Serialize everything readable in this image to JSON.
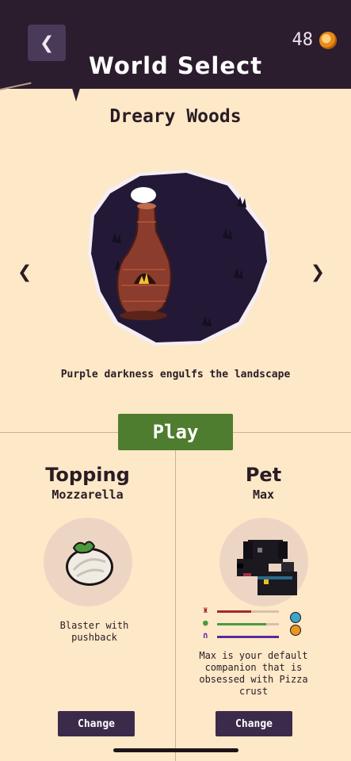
{
  "header": {
    "title": "World Select",
    "back_icon": "chevron-left-icon",
    "coins": "48",
    "coin_icon": "coin-icon"
  },
  "world": {
    "name": "Dreary Woods",
    "description": "Purple darkness engulfs the landscape",
    "image": "pizza-oven-dark-forest"
  },
  "play_label": "Play",
  "topping": {
    "heading": "Topping",
    "name": "Mozzarella",
    "description": "Blaster with pushback",
    "button_label": "Change",
    "image": "mozzarella-icon"
  },
  "pet": {
    "heading": "Pet",
    "name": "Max",
    "description": "Max is your default companion that is obsessed with Pizza crust",
    "button_label": "Change",
    "image": "black-dog-icon",
    "stats": [
      {
        "icon": "strength-icon",
        "color": "#a8262a",
        "value": 0.55
      },
      {
        "icon": "range-icon",
        "color": "#4a9a3c",
        "value": 0.8
      },
      {
        "icon": "magnet-icon",
        "color": "#5a2a9a",
        "value": 1.0
      }
    ],
    "badge_icons": [
      "gem-icon",
      "coin-icon"
    ]
  },
  "colors": {
    "accent_green": "#4f7d2f",
    "header": "#2b1c2e",
    "button_dark": "#3b2a4a",
    "background": "#fde8c8"
  }
}
